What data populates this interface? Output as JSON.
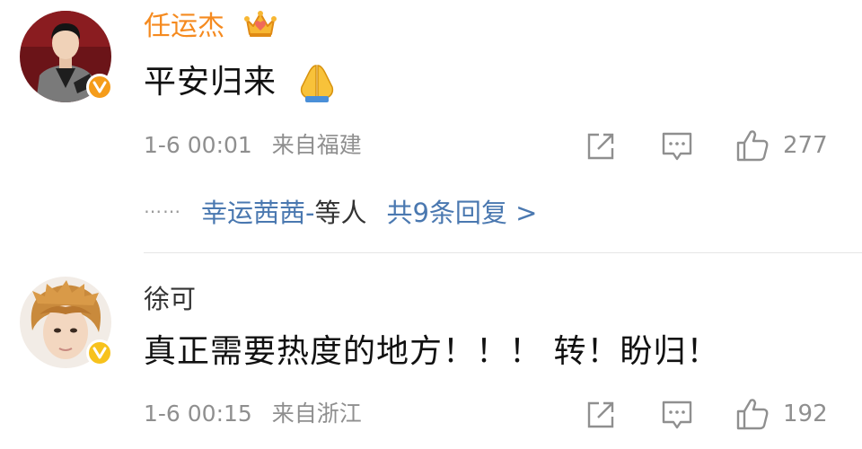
{
  "colors": {
    "brand_orange": "#f58a1f",
    "link_blue": "#4a78b0",
    "meta_gray": "#8f8f8f",
    "text_dark": "#111111",
    "verified_orange": "#f59c1a",
    "verified_yellow": "#f7c21d"
  },
  "comments": [
    {
      "username": "任运杰",
      "username_color": "#f58a1f",
      "badge_icon": "crown-icon",
      "content": "平安归来",
      "emoji_icon": "praying-hands-icon",
      "time": "1-6 00:01",
      "location": "来自福建",
      "likes": "277",
      "verified_icon": "verified-v-icon",
      "replies": {
        "dots": "⋯⋯",
        "names": "幸运茜茜-",
        "etc": "等人",
        "count_text": "共9条回复 >"
      }
    },
    {
      "username": "徐可",
      "username_color": "#333333",
      "content": "真正需要热度的地方！！！ 转！盼归！",
      "time": "1-6 00:15",
      "location": "来自浙江",
      "likes": "192",
      "verified_icon": "verified-v-icon"
    }
  ]
}
